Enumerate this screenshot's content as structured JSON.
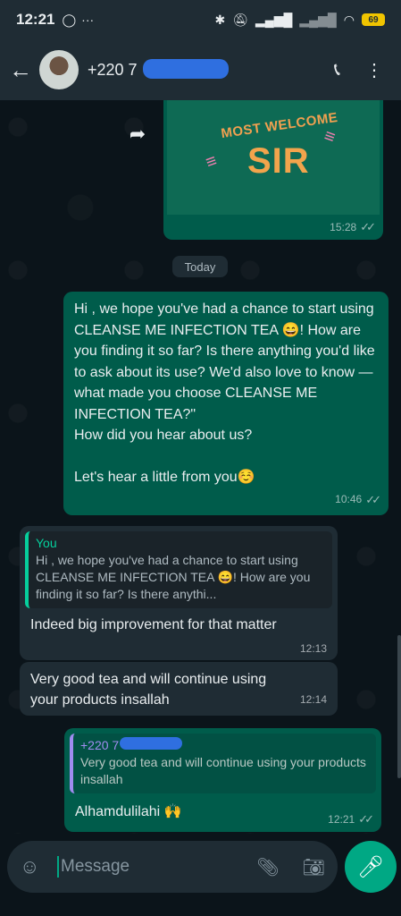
{
  "status_bar": {
    "time": "12:21",
    "battery": "69"
  },
  "header": {
    "contact_visible": "+220 7"
  },
  "messages": {
    "welcome_image": {
      "line1": "MOST WELCOME",
      "line2": "SIR",
      "time": "15:28"
    },
    "date_divider": "Today",
    "msg1": {
      "text": "Hi , we hope you've had a chance to start using CLEANSE ME INFECTION TEA 😄! How are you finding it so far? Is there anything you'd like to ask about its use? We'd also love to know —\nwhat made you choose CLEANSE ME INFECTION TEA?\"\nHow did you hear about us?\n\nLet's hear a little from you☺️",
      "time": "10:46"
    },
    "msg2": {
      "quote_name": "You",
      "quote_text": "Hi , we hope you've had a chance to start using CLEANSE ME INFECTION TEA 😄! How are you finding it so far? Is there anythi...",
      "text": "Indeed big improvement for that matter",
      "time": "12:13"
    },
    "msg3": {
      "text": "Very good tea and will continue using your products insallah",
      "time": "12:14"
    },
    "msg4": {
      "quote_name": "+220 7",
      "quote_text": "Very good tea and will continue using your products insallah",
      "text": "Alhamdulilahi 🙌",
      "time": "12:21"
    }
  },
  "input": {
    "placeholder": "Message"
  }
}
